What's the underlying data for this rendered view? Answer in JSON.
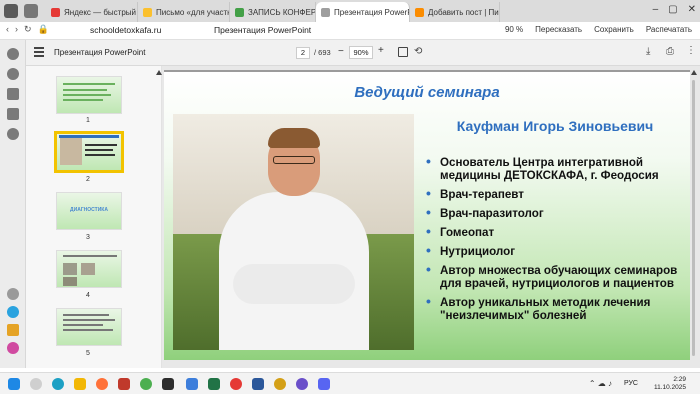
{
  "browser": {
    "tabs": [
      {
        "label": "Яндекс — быстрый поиск",
        "color": "#e53935",
        "active": false
      },
      {
        "label": "Письмо «для участников»",
        "color": "#fbc02d",
        "active": false
      },
      {
        "label": "ЗАПИСЬ КОНФЕРЕНЦИИ",
        "color": "#43a047",
        "active": false
      },
      {
        "label": "Презентация PowerPoint",
        "color": "#9e9e9e",
        "active": true
      },
      {
        "label": "Добавить пост | Пикабу",
        "color": "#fb8c00",
        "active": false
      }
    ],
    "url": "schooldetoxkafa.ru",
    "page_title": "Презентация PowerPoint",
    "zoom_indicator": "90 %",
    "translate_label": "Пересказать",
    "save_label": "Сохранить",
    "print_label": "Распечатать"
  },
  "pdf_toolbar": {
    "title": "Презентация PowerPoint",
    "current_page": "2",
    "total_pages": "/ 693",
    "zoom": "90%"
  },
  "thumbnails": [
    {
      "num": "1",
      "selected": false
    },
    {
      "num": "2",
      "selected": true
    },
    {
      "num": "3",
      "selected": false,
      "text": "ДИАГНОСТИКА"
    },
    {
      "num": "4",
      "selected": false
    },
    {
      "num": "5",
      "selected": false
    }
  ],
  "slide": {
    "title": "Ведущий семинара",
    "person_name": "Кауфман Игорь Зиновьевич",
    "bullets": [
      "Основатель Центра интегративной медицины ДЕТОКСКАФА, г. Феодосия",
      "Врач-терапевт",
      "Врач-паразитолог",
      "Гомеопат",
      "Нутрициолог",
      "Автор множества обучающих семинаров для врачей, нутрициологов и пациентов",
      "Автор уникальных методик лечения \"неизлечимых\" болезней"
    ]
  },
  "taskbar": {
    "lang": "РУС",
    "time": "2:29",
    "date": "11.10.2025"
  },
  "colors": {
    "accent_blue": "#2f6fbf",
    "slide_green": "#8fd07c",
    "selected_thumb": "#f2c300"
  }
}
